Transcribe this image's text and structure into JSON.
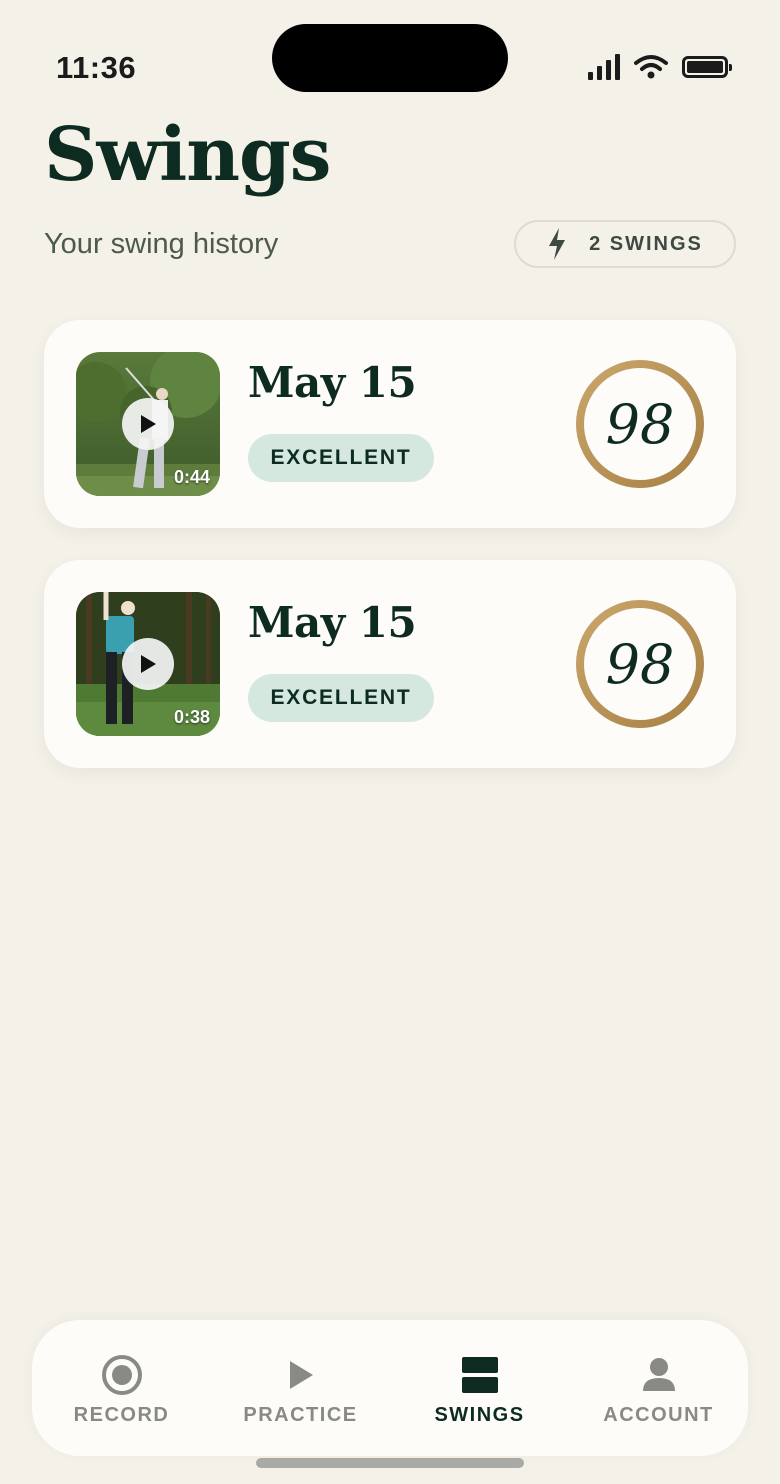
{
  "status": {
    "time": "11:36"
  },
  "header": {
    "title": "Swings",
    "subtitle": "Your swing history",
    "count_label": "2 SWINGS"
  },
  "swings": [
    {
      "date": "May 15",
      "rating": "EXCELLENT",
      "score": "98",
      "score_progress": 1.0,
      "duration": "0:44"
    },
    {
      "date": "May 15",
      "rating": "EXCELLENT",
      "score": "98",
      "score_progress": 1.0,
      "duration": "0:38"
    }
  ],
  "tabs": [
    {
      "label": "RECORD",
      "icon": "record-icon",
      "active": false
    },
    {
      "label": "PRACTICE",
      "icon": "play-icon",
      "active": false
    },
    {
      "label": "SWINGS",
      "icon": "swings-icon",
      "active": true
    },
    {
      "label": "ACCOUNT",
      "icon": "person-icon",
      "active": false
    }
  ],
  "colors": {
    "background": "#f4f1e8",
    "title": "#0e2b22",
    "badge_bg": "#d4e8df",
    "score_ring": "#b8935a",
    "active_indicator": "#2e6b52"
  }
}
